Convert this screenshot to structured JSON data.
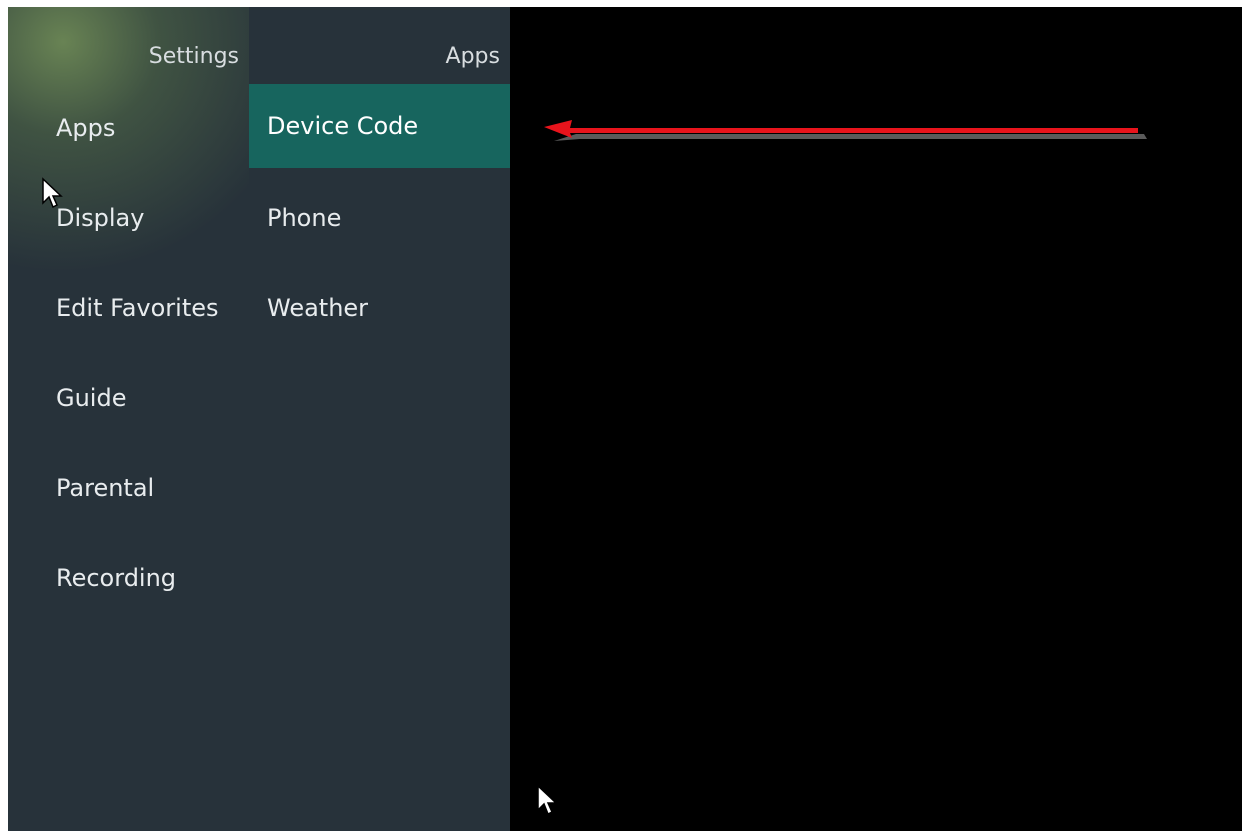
{
  "settings": {
    "title": "Settings",
    "items": [
      {
        "label": "Apps"
      },
      {
        "label": "Display"
      },
      {
        "label": "Edit Favorites"
      },
      {
        "label": "Guide"
      },
      {
        "label": "Parental"
      },
      {
        "label": "Recording"
      }
    ]
  },
  "apps": {
    "title": "Apps",
    "items": [
      {
        "label": "Device Code",
        "selected": true
      },
      {
        "label": "Phone"
      },
      {
        "label": "Weather"
      }
    ]
  },
  "colors": {
    "panel": "#27323a",
    "selected": "#17655e",
    "background": "#000000",
    "arrow": "#e8141c"
  },
  "icons": {
    "cursor": "mouse-pointer-icon",
    "annotation": "red-arrow-icon"
  }
}
